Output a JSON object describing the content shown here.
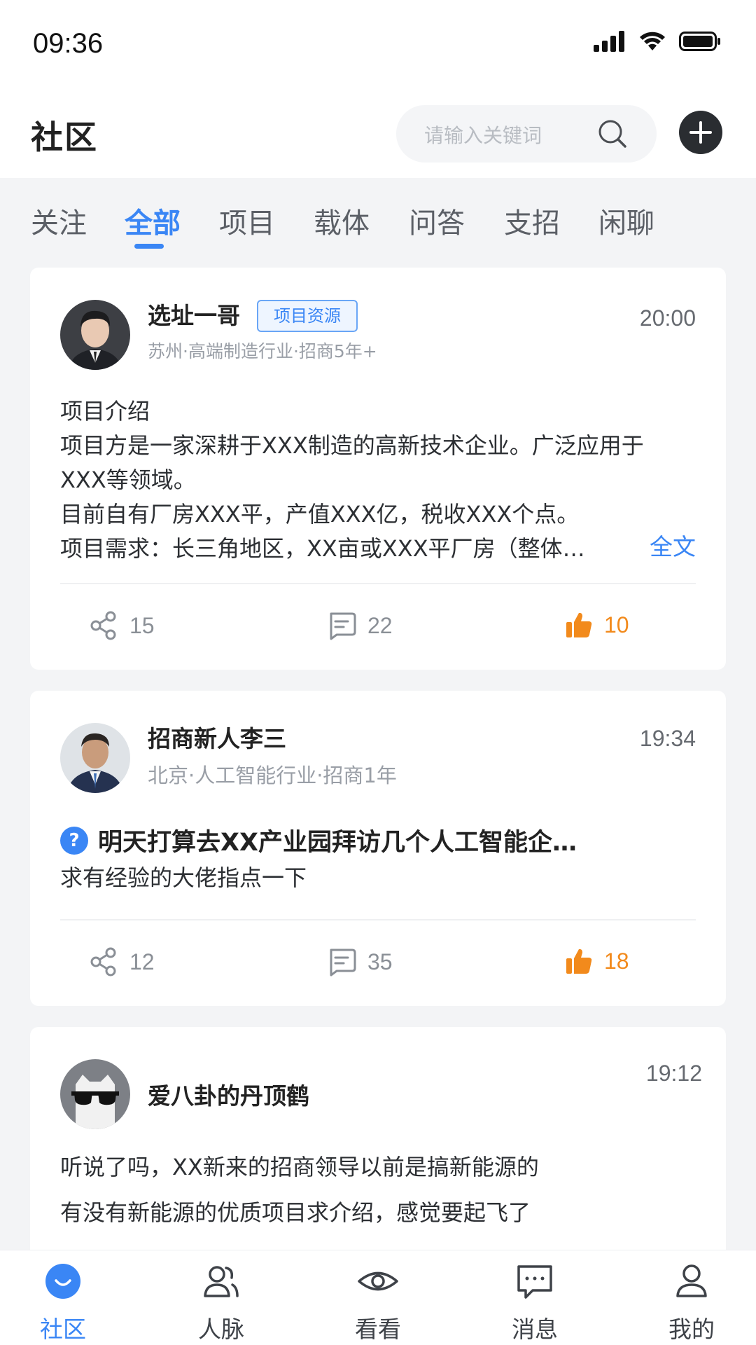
{
  "status_bar": {
    "time": "09:36"
  },
  "header": {
    "title": "社区",
    "search": {
      "placeholder": "请输入关键词"
    }
  },
  "tabs": [
    {
      "label": "关注"
    },
    {
      "label": "全部",
      "active": true
    },
    {
      "label": "项目"
    },
    {
      "label": "载体"
    },
    {
      "label": "问答"
    },
    {
      "label": "支招"
    },
    {
      "label": "闲聊"
    }
  ],
  "posts": [
    {
      "author": "选址一哥",
      "tag": "项目资源",
      "meta": "苏州·高端制造行业·招商5年+",
      "time": "20:00",
      "lines": [
        "项目介绍",
        "项目方是一家深耕于XXX制造的高新技术企业。广泛应用于",
        "XXX等领域。",
        "目前自有厂房XXX平，产值XXX亿，税收XXX个点。",
        "项目需求：长三角地区，XX亩或XXX平厂房（整体…"
      ],
      "full_text_label": "全文",
      "shares": "15",
      "comments": "22",
      "likes": "10"
    },
    {
      "author": "招商新人李三",
      "meta": "北京·人工智能行业·招商1年",
      "time": "19:34",
      "question_icon": "?",
      "question": "明天打算去XX产业园拜访几个人工智能企…",
      "lines": [
        "求有经验的大佬指点一下"
      ],
      "shares": "12",
      "comments": "35",
      "likes": "18"
    },
    {
      "author": "爱八卦的丹顶鹤",
      "time": "19:12",
      "lines": [
        "听说了吗，XX新来的招商领导以前是搞新能源的",
        "有没有新能源的优质项目求介绍，感觉要起飞了"
      ]
    }
  ],
  "bottom_nav": [
    {
      "label": "社区",
      "icon": "community-icon",
      "active": true
    },
    {
      "label": "人脉",
      "icon": "contacts-icon"
    },
    {
      "label": "看看",
      "icon": "eye-icon"
    },
    {
      "label": "消息",
      "icon": "message-icon"
    },
    {
      "label": "我的",
      "icon": "profile-icon"
    }
  ],
  "colors": {
    "accent": "#3a86f5",
    "like": "#f28a1c",
    "background": "#f3f4f6"
  }
}
